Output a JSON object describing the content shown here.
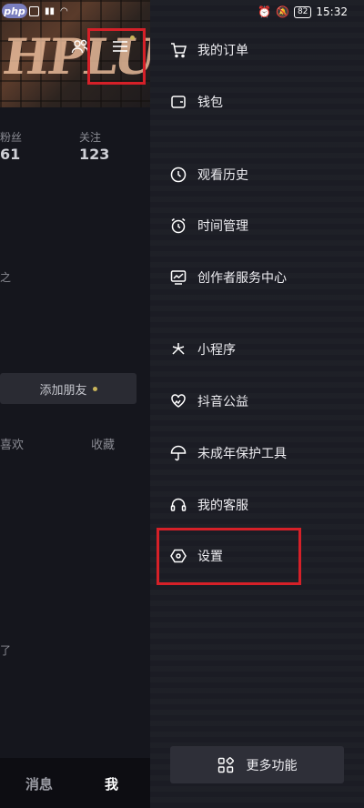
{
  "status_bar": {
    "logo": "php",
    "time": "15:32",
    "battery": "82",
    "icons": [
      "alarm-icon",
      "mute-icon",
      "battery-icon"
    ]
  },
  "profile_background": {
    "neon_text": "HPLU",
    "stats": [
      {
        "label": "粉丝",
        "value": "61"
      },
      {
        "label": "关注",
        "value": "123"
      }
    ],
    "snippet_1": "之",
    "add_friend": "添加朋友",
    "tabs": [
      "喜欢",
      "收藏"
    ],
    "snippet_2": "了",
    "bottom_nav": [
      "消息",
      "我"
    ]
  },
  "drawer": {
    "items": [
      {
        "label": "我的订单",
        "icon": "cart-icon"
      },
      {
        "label": "钱包",
        "icon": "wallet-icon"
      },
      {
        "label": "观看历史",
        "icon": "clock-icon"
      },
      {
        "label": "时间管理",
        "icon": "alarm-clock-icon"
      },
      {
        "label": "创作者服务中心",
        "icon": "chart-icon"
      },
      {
        "label": "小程序",
        "icon": "asterisk-icon"
      },
      {
        "label": "抖音公益",
        "icon": "heart-hands-icon"
      },
      {
        "label": "未成年保护工具",
        "icon": "umbrella-icon"
      },
      {
        "label": "我的客服",
        "icon": "headset-icon"
      },
      {
        "label": "设置",
        "icon": "hexagon-gear-icon"
      }
    ],
    "more_button": {
      "label": "更多功能",
      "icon": "grid-icon"
    }
  },
  "colors": {
    "highlight": "#d52028",
    "drawer_bg": "#1b1c24",
    "accent_dot": "#c9b45a"
  }
}
